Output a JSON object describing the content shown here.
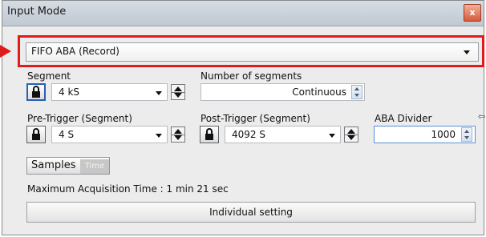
{
  "window": {
    "title": "Input Mode",
    "close_glyph": "x"
  },
  "mode": {
    "selected": "FIFO ABA (Record)"
  },
  "segment": {
    "label": "Segment",
    "value": "4 kS"
  },
  "number_of_segments": {
    "label": "Number of segments",
    "value": "Continuous"
  },
  "pre_trigger": {
    "label": "Pre-Trigger (Segment)",
    "value": "4 S"
  },
  "post_trigger": {
    "label": "Post-Trigger (Segment)",
    "value": "4092 S"
  },
  "aba_divider": {
    "label": "ABA Divider",
    "value": "1000"
  },
  "unit_toggle": {
    "active": "Samples",
    "inactive": "Time"
  },
  "status": {
    "max_acq": "Maximum Acquisition Time : 1 min 21 sec"
  },
  "buttons": {
    "individual_setting": "Individual setting"
  },
  "colors": {
    "highlight": "#e01b1b",
    "lock_active_border": "#2a5fb4",
    "close": "#d9593a"
  },
  "icons": [
    "lock-icon",
    "dropdown-arrow-icon",
    "spinner-icon",
    "close-icon",
    "callout-arrow-icon",
    "resize-arrow-icon"
  ]
}
